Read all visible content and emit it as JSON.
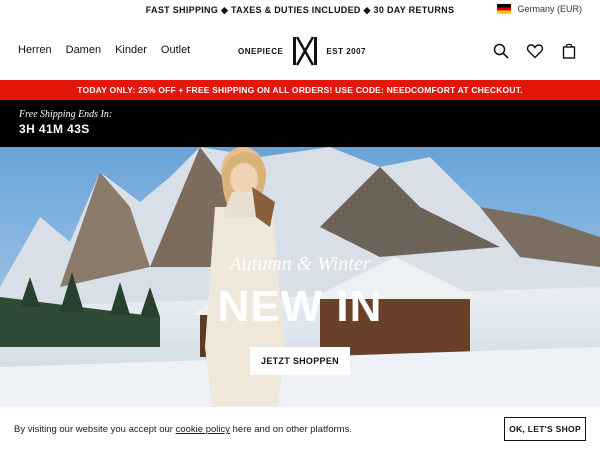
{
  "topbar": {
    "message": "FAST SHIPPING ◆ TAXES & DUTIES INCLUDED ◆ 30 DAY RETURNS",
    "region": "Germany (EUR)",
    "flag_icon": "germany-flag-icon"
  },
  "header": {
    "nav": [
      "Herren",
      "Damen",
      "Kinder",
      "Outlet"
    ],
    "brand": "ONEPIECE",
    "est": "EST  2007",
    "icons": [
      "search-icon",
      "heart-icon",
      "shopping-bag-icon"
    ]
  },
  "promo": {
    "text": "TODAY ONLY: 25% OFF + FREE SHIPPING ON ALL ORDERS! USE CODE: NEEDCOMFORT AT CHECKOUT.",
    "color": "#e4160a"
  },
  "timer": {
    "label": "Free Shipping Ends In:",
    "time": "3H 41M 43S"
  },
  "hero": {
    "subtitle": "Autumn & Winter",
    "title": "NEW IN",
    "cta": "JETZT SHOPPEN"
  },
  "cookie": {
    "text_before": "By visiting our website you accept our ",
    "link": "cookie policy",
    "text_after": " here and on other platforms.",
    "button": "OK, LET'S SHOP"
  }
}
